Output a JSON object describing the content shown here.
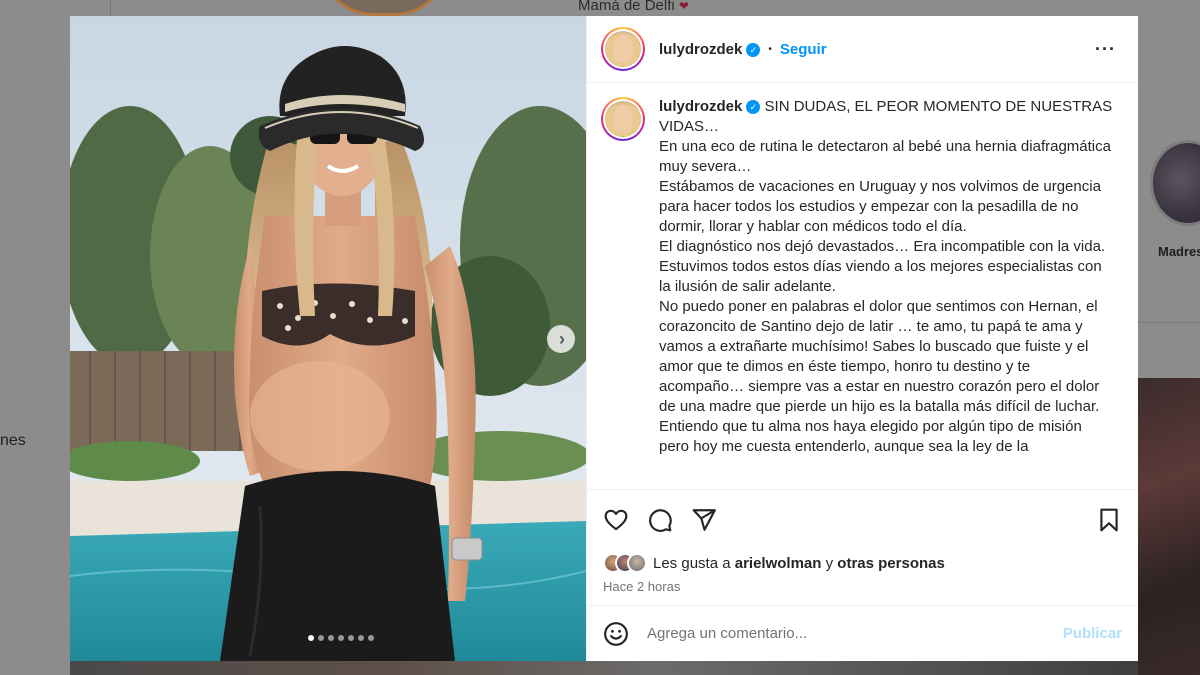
{
  "background": {
    "caption_fragment": "Mamá de Delfi",
    "left_text_fragment": "nes",
    "right_label_fragment": "Madres"
  },
  "post": {
    "username": "lulydrozdek",
    "follow_label": "Seguir",
    "more_icon": "more-options-icon",
    "caption_lines": [
      "SIN DUDAS, EL PEOR MOMENTO DE NUESTRAS VIDAS…",
      "En una eco de rutina le detectaron al bebé una hernia diafragmática muy severa…",
      "Estábamos de vacaciones en Uruguay y nos volvimos de urgencia para hacer todos los estudios y empezar con la pesadilla de no dormir, llorar y hablar con médicos todo el día.",
      "El diagnóstico nos dejó devastados… Era incompatible con la vida.",
      "Estuvimos todos estos días viendo a los mejores especialistas con la ilusión de salir adelante.",
      "No puedo poner en palabras el dolor que sentimos con Hernan, el corazoncito de Santino dejo de latir … te amo, tu papá te ama y vamos a extrañarte muchísimo! Sabes lo buscado que fuiste y el amor que te dimos en éste tiempo, honro tu destino y te acompaño… siempre vas a estar en nuestro corazón pero el dolor de una madre que pierde un hijo es la batalla más difícil de luchar. Entiendo que tu alma nos haya elegido por algún tipo de misión pero hoy me cuesta entenderlo, aunque sea la ley de la"
    ],
    "likes": {
      "prefix": "Les gusta a",
      "user": "arielwolman",
      "connector": "y",
      "others": "otras personas"
    },
    "time_ago": "Hace 2 horas",
    "comment_placeholder": "Agrega un comentario...",
    "publish_label": "Publicar",
    "carousel": {
      "total_slides": 7,
      "current_slide": 1
    }
  },
  "colors": {
    "accent": "#0095f6",
    "publish_disabled": "#b2dffc",
    "muted": "#737373"
  }
}
